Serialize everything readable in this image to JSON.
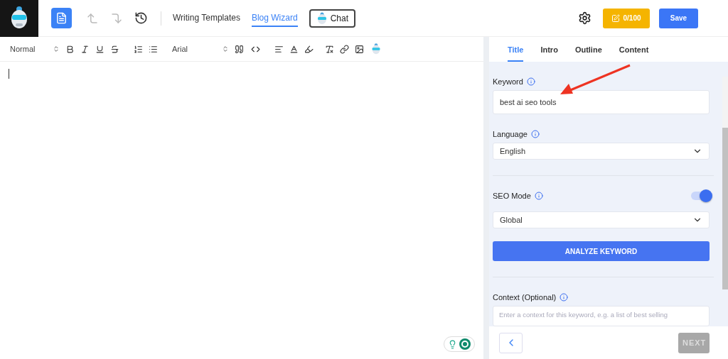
{
  "header": {
    "nav": [
      {
        "label": "Writing Templates",
        "selected": false
      },
      {
        "label": "Blog Wizard",
        "selected": true
      }
    ],
    "chat": "Chat",
    "credits": "0/100",
    "save": "Save"
  },
  "toolbar": {
    "style": "Normal",
    "font": "Arial"
  },
  "tabs": [
    {
      "label": "Title",
      "selected": true
    },
    {
      "label": "Intro",
      "selected": false
    },
    {
      "label": "Outline",
      "selected": false
    },
    {
      "label": "Content",
      "selected": false
    }
  ],
  "form": {
    "keyword_label": "Keyword",
    "keyword_value": "best ai seo tools",
    "language_label": "Language",
    "language_value": "English",
    "seo_mode_label": "SEO Mode",
    "seo_mode_on": true,
    "seo_scope": "Global",
    "analyze": "ANALYZE KEYWORD",
    "context_label": "Context (Optional)",
    "context_placeholder": "Enter a context for this keyword, e.g. a list of best selling"
  },
  "footer": {
    "next": "NEXT",
    "next_disabled": true
  }
}
